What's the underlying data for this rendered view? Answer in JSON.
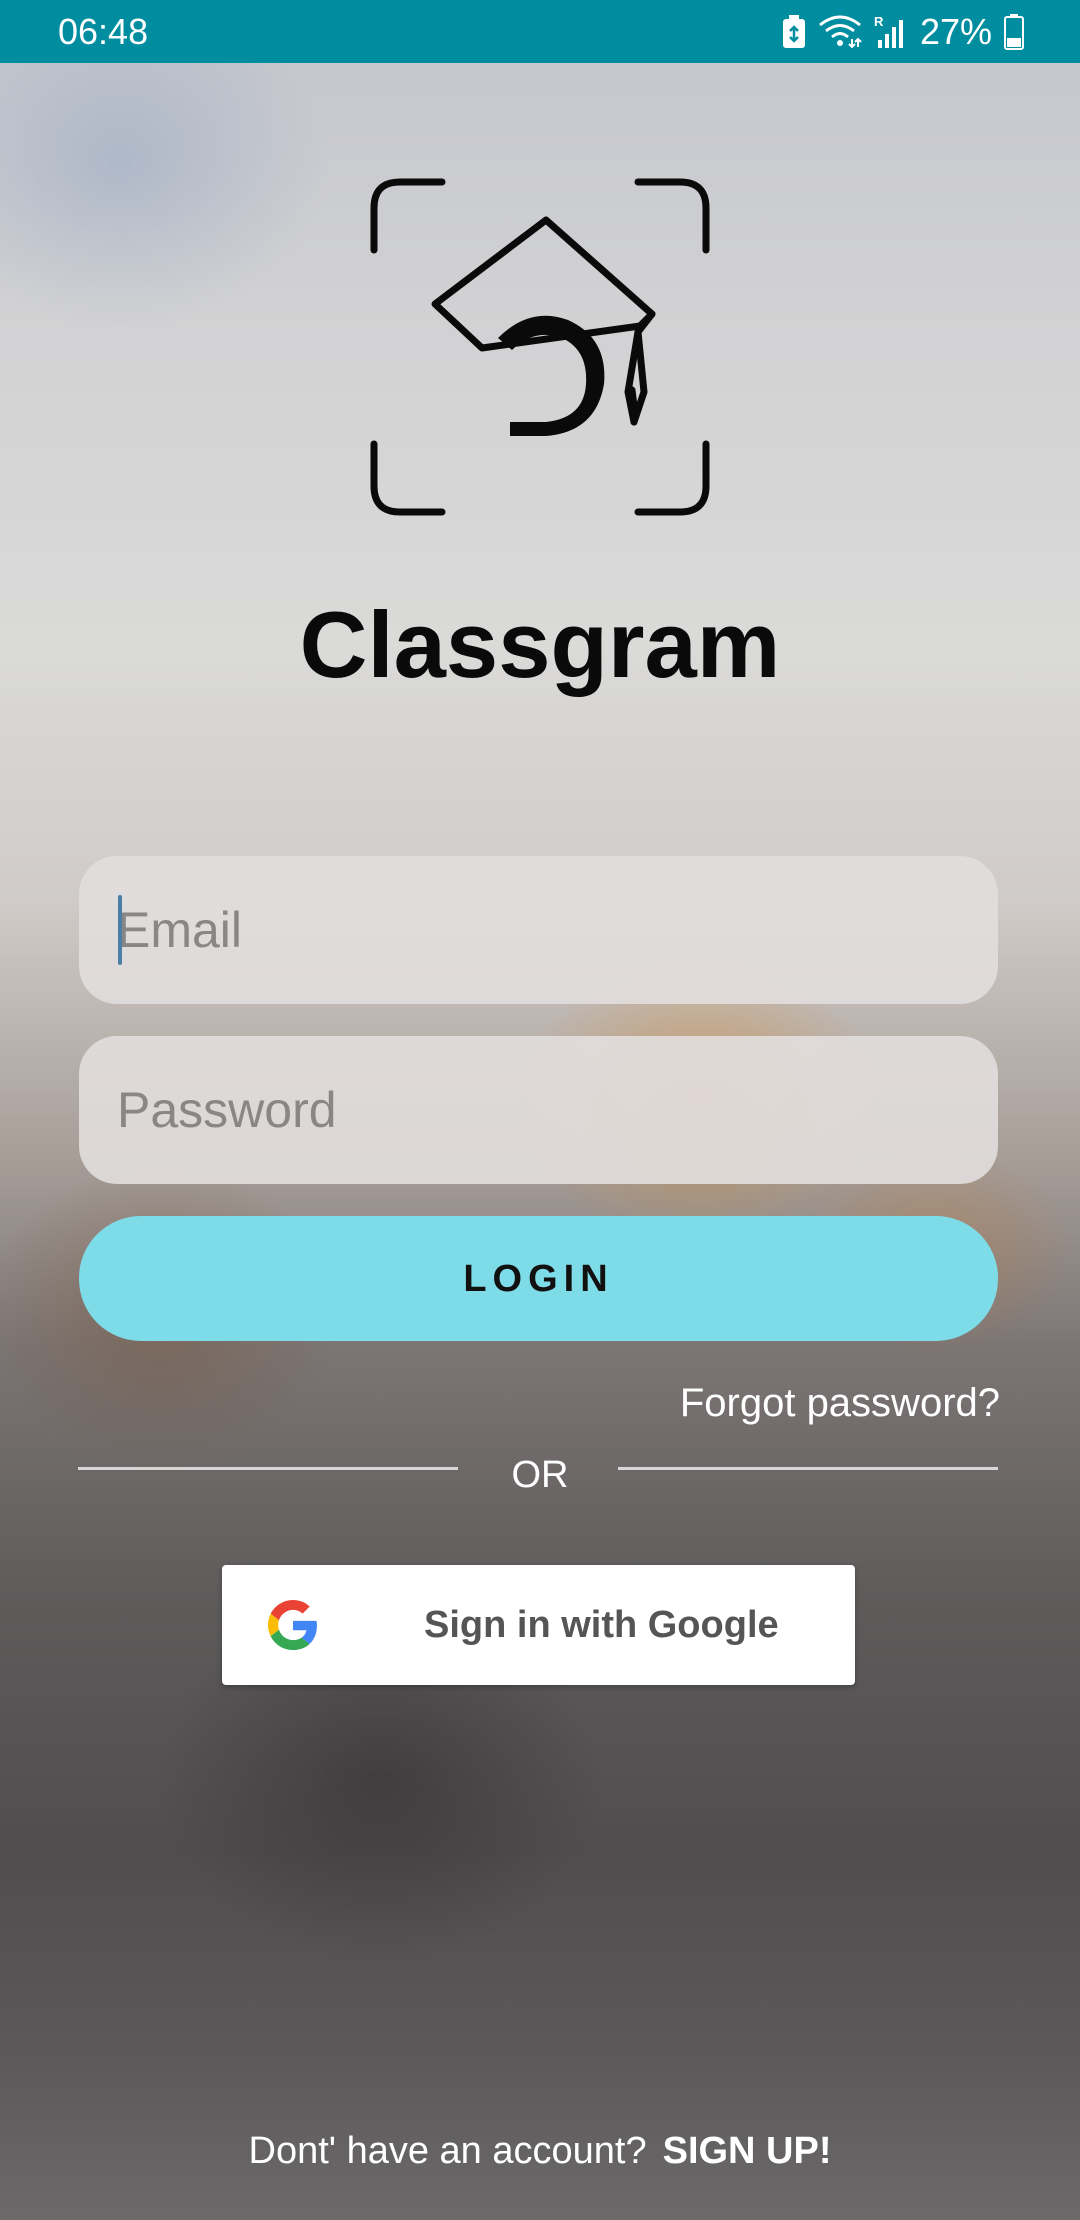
{
  "status_bar": {
    "time": "06:48",
    "battery_percent": "27%",
    "icons": [
      "battery-saver-icon",
      "wifi-icon",
      "signal-roaming-icon",
      "battery-icon"
    ],
    "background_color": "#008da0"
  },
  "app": {
    "name": "Classgram",
    "logo_icon": "graduation-cap-scan-icon"
  },
  "login_form": {
    "email_placeholder": "Email",
    "email_value": "",
    "password_placeholder": "Password",
    "password_value": "",
    "login_button_label": "LOGIN",
    "login_button_color": "#7edbe8",
    "forgot_password_label": "Forgot password?"
  },
  "divider": {
    "label": "OR"
  },
  "google_sign_in": {
    "label": "Sign in with Google",
    "icon": "google-icon"
  },
  "footer": {
    "prompt": "Dont' have an account?",
    "signup_label": "SIGN UP!"
  }
}
